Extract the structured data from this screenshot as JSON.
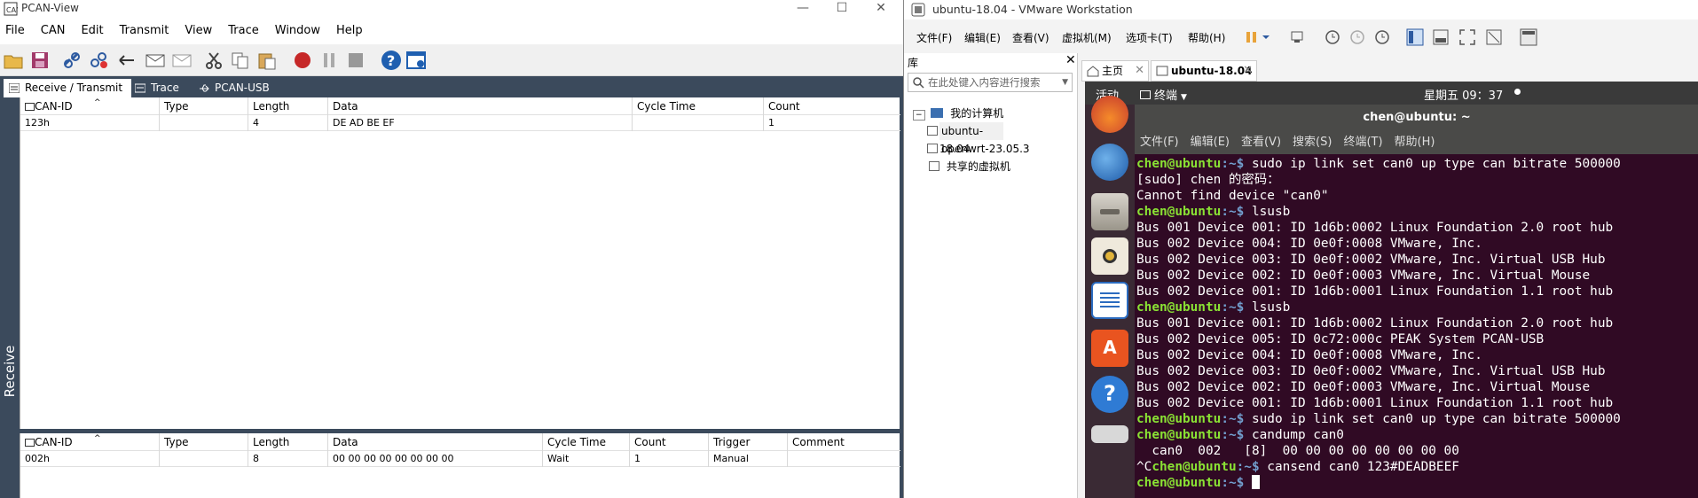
{
  "pcan": {
    "title": "PCAN-View",
    "menu": [
      "File",
      "CAN",
      "Edit",
      "Transmit",
      "View",
      "Trace",
      "Window",
      "Help"
    ],
    "tabs": [
      "Receive / Transmit",
      "Trace",
      "PCAN-USB"
    ],
    "side_label": "Receive",
    "receive": {
      "headers": [
        "CAN-ID",
        "Type",
        "Length",
        "Data",
        "Cycle Time",
        "Count"
      ],
      "rows": [
        [
          "123h",
          "",
          "4",
          "DE AD BE EF",
          "",
          "1"
        ]
      ]
    },
    "transmit": {
      "headers": [
        "CAN-ID",
        "Type",
        "Length",
        "Data",
        "Cycle Time",
        "Count",
        "Trigger",
        "Comment"
      ],
      "rows": [
        [
          "002h",
          "",
          "8",
          "00 00 00 00 00 00 00 00",
          "Wait",
          "1",
          "Manual",
          ""
        ]
      ]
    }
  },
  "vm": {
    "title": "ubuntu-18.04 - VMware Workstation",
    "menu": [
      "文件(F)",
      "编辑(E)",
      "查看(V)",
      "虚拟机(M)",
      "选项卡(T)",
      "帮助(H)"
    ],
    "library": {
      "header": "库",
      "search_placeholder": "在此处键入内容进行搜索",
      "tree": [
        "我的计算机",
        "ubuntu-18.04",
        "openwrt-23.05.3",
        "共享的虚拟机"
      ]
    },
    "tabs": [
      "主页",
      "ubuntu-18.04"
    ]
  },
  "ubuntu": {
    "activities": "活动",
    "app": "终端",
    "clock": "星期五 09：37",
    "term_title": "chen@ubuntu: ~",
    "term_menu": [
      "文件(F)",
      "编辑(E)",
      "查看(V)",
      "搜索(S)",
      "终端(T)",
      "帮助(H)"
    ],
    "prompt_user": "chen@ubuntu",
    "prompt_path": ":~$",
    "lines": [
      {
        "p": true,
        "t": " sudo ip link set can0 up type can bitrate 500000"
      },
      {
        "p": false,
        "t": "[sudo] chen 的密码："
      },
      {
        "p": false,
        "t": "Cannot find device \"can0\""
      },
      {
        "p": true,
        "t": " lsusb"
      },
      {
        "p": false,
        "t": "Bus 001 Device 001: ID 1d6b:0002 Linux Foundation 2.0 root hub"
      },
      {
        "p": false,
        "t": "Bus 002 Device 004: ID 0e0f:0008 VMware, Inc."
      },
      {
        "p": false,
        "t": "Bus 002 Device 003: ID 0e0f:0002 VMware, Inc. Virtual USB Hub"
      },
      {
        "p": false,
        "t": "Bus 002 Device 002: ID 0e0f:0003 VMware, Inc. Virtual Mouse"
      },
      {
        "p": false,
        "t": "Bus 002 Device 001: ID 1d6b:0001 Linux Foundation 1.1 root hub"
      },
      {
        "p": true,
        "t": " lsusb"
      },
      {
        "p": false,
        "t": "Bus 001 Device 001: ID 1d6b:0002 Linux Foundation 2.0 root hub"
      },
      {
        "p": false,
        "t": "Bus 002 Device 005: ID 0c72:000c PEAK System PCAN-USB"
      },
      {
        "p": false,
        "t": "Bus 002 Device 004: ID 0e0f:0008 VMware, Inc."
      },
      {
        "p": false,
        "t": "Bus 002 Device 003: ID 0e0f:0002 VMware, Inc. Virtual USB Hub"
      },
      {
        "p": false,
        "t": "Bus 002 Device 002: ID 0e0f:0003 VMware, Inc. Virtual Mouse"
      },
      {
        "p": false,
        "t": "Bus 002 Device 001: ID 1d6b:0001 Linux Foundation 1.1 root hub"
      },
      {
        "p": true,
        "t": " sudo ip link set can0 up type can bitrate 500000"
      },
      {
        "p": true,
        "t": " candump can0"
      },
      {
        "p": false,
        "t": "  can0  002   [8]  00 00 00 00 00 00 00 00"
      },
      {
        "p": true,
        "pre": "^C",
        "t": " cansend can0 123#DEADBEEF"
      },
      {
        "p": true,
        "t": " ",
        "cursor": true
      }
    ]
  }
}
